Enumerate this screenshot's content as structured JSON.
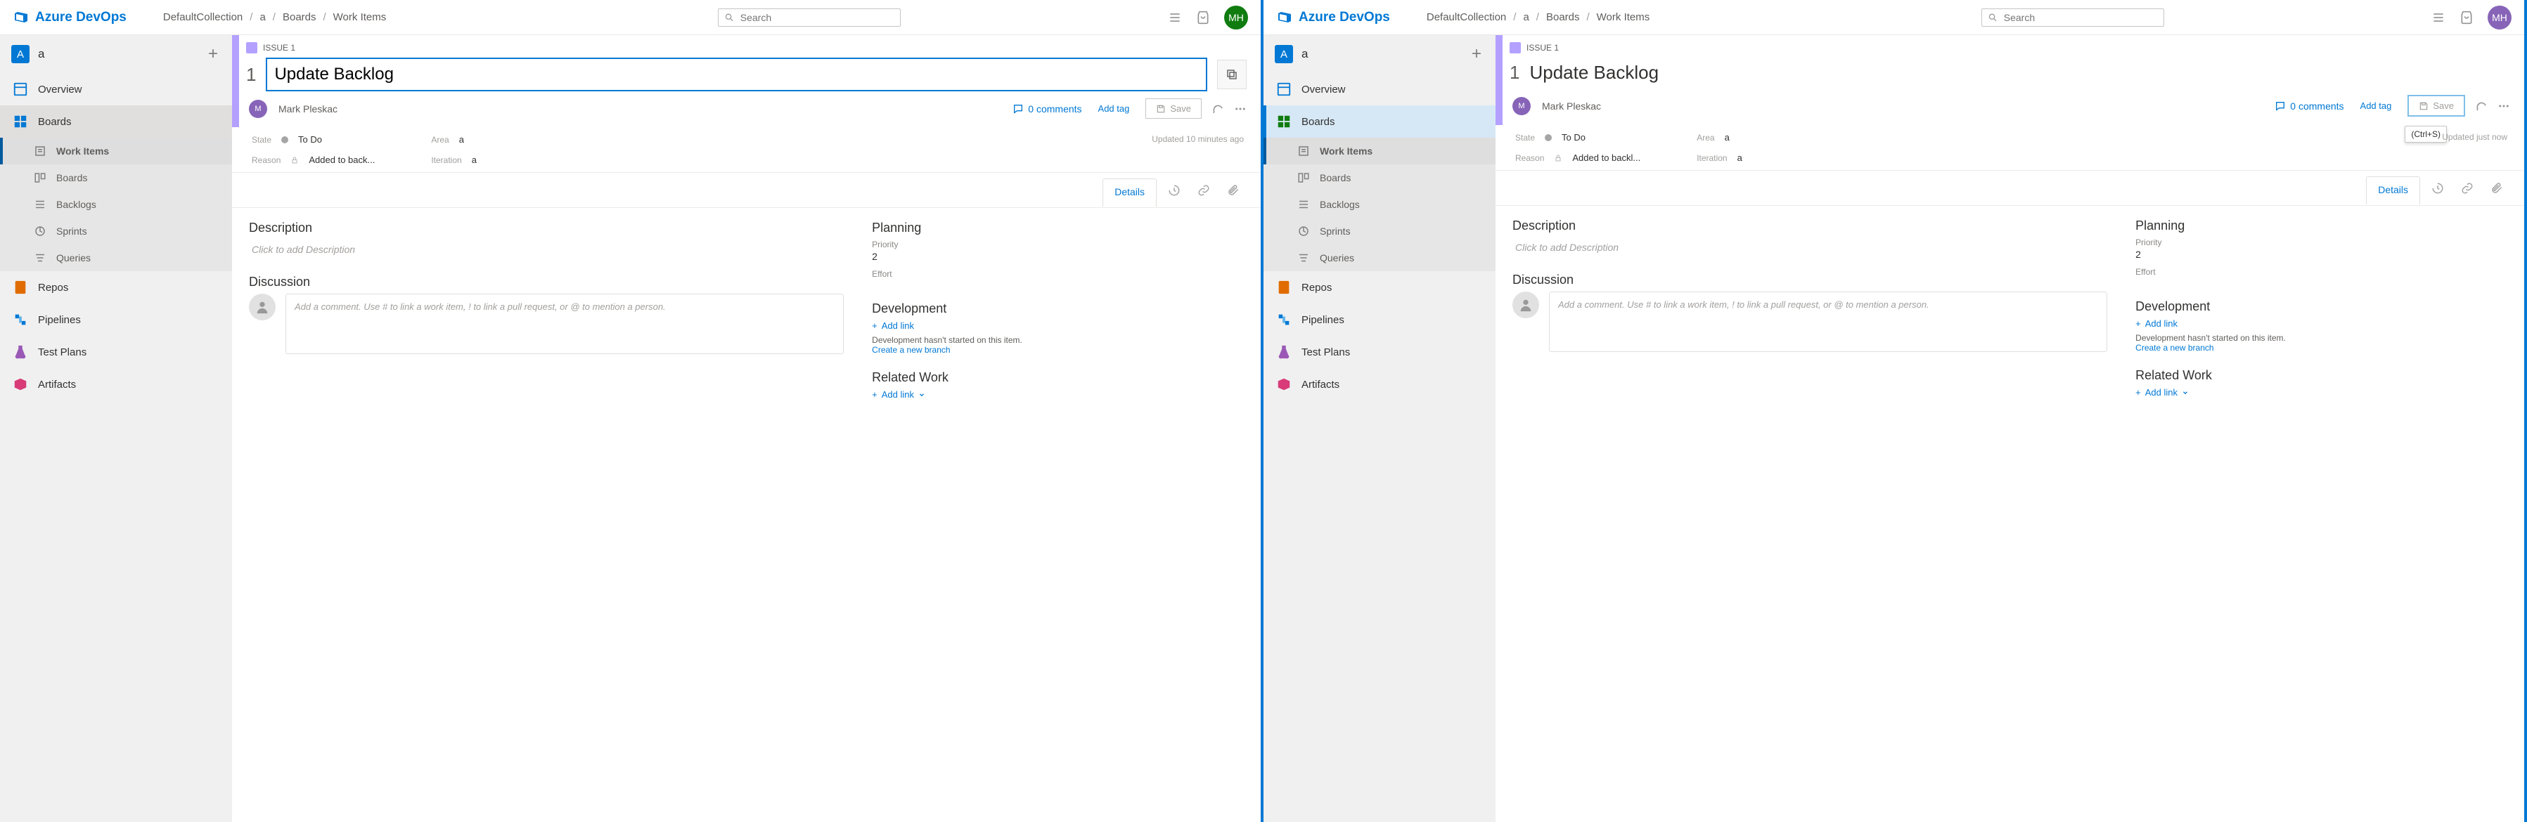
{
  "icons": {
    "app_title": "Azure DevOps",
    "avatar_initials": "MH"
  },
  "breadcrumb": [
    "DefaultCollection",
    "a",
    "Boards",
    "Work Items"
  ],
  "search_placeholder": "Search",
  "sidebar": {
    "project": "a",
    "items": [
      {
        "label": "Overview"
      },
      {
        "label": "Boards"
      },
      {
        "label": "Repos"
      },
      {
        "label": "Pipelines"
      },
      {
        "label": "Test Plans"
      },
      {
        "label": "Artifacts"
      }
    ],
    "boards_children": [
      {
        "label": "Work Items"
      },
      {
        "label": "Boards"
      },
      {
        "label": "Backlogs"
      },
      {
        "label": "Sprints"
      },
      {
        "label": "Queries"
      }
    ]
  },
  "workitem": {
    "type_label": "ISSUE 1",
    "number": "1",
    "title": "Update Backlog",
    "assignee": "Mark Pleskac",
    "comments": "0 comments",
    "add_tag": "Add tag",
    "save": "Save",
    "save_shortcut": "(Ctrl+S)",
    "state_label": "State",
    "state_value": "To Do",
    "reason_label": "Reason",
    "reason_value_left": "Added to back...",
    "reason_value_right": "Added to backl...",
    "area_label": "Area",
    "area_value": "a",
    "iteration_label": "Iteration",
    "iteration_value": "a",
    "updated_left": "Updated 10 minutes ago",
    "updated_right": "Updated just now",
    "tabs": {
      "details": "Details"
    },
    "description_heading": "Description",
    "description_placeholder": "Click to add Description",
    "discussion_heading": "Discussion",
    "discussion_placeholder": "Add a comment. Use # to link a work item, ! to link a pull request, or @ to mention a person.",
    "planning_heading": "Planning",
    "priority_label": "Priority",
    "priority_value": "2",
    "effort_label": "Effort",
    "development_heading": "Development",
    "add_link": "Add link",
    "dev_note": "Development hasn't started on this item.",
    "dev_branch": "Create a new branch",
    "related_heading": "Related Work"
  }
}
